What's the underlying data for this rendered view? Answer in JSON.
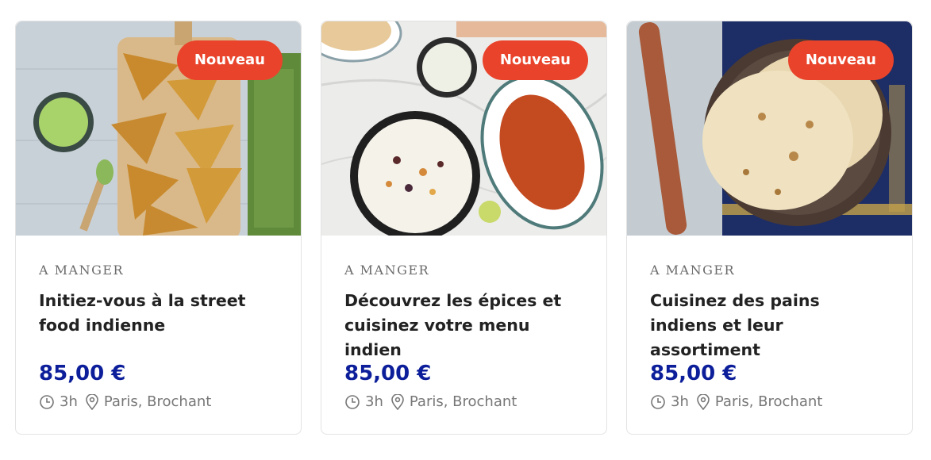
{
  "cards": [
    {
      "image": "samosas-with-green-chutney",
      "badge": "Nouveau",
      "category": "A MANGER",
      "title": "Initiez-vous à la street food indienne",
      "price": "85,00 €",
      "duration": "3h",
      "location": "Paris, Brochant"
    },
    {
      "image": "rice-curry-and-raita",
      "badge": "Nouveau",
      "category": "A MANGER",
      "title": "Découvrez les épices et cuisinez votre menu indien",
      "price": "85,00 €",
      "duration": "3h",
      "location": "Paris, Brochant"
    },
    {
      "image": "indian-flatbreads-naan",
      "badge": "Nouveau",
      "category": "A MANGER",
      "title": "Cuisinez des pains indiens et leur assortiment",
      "price": "85,00 €",
      "duration": "3h",
      "location": "Paris, Brochant"
    }
  ],
  "colors": {
    "badge_bg": "#e9442b",
    "price": "#0c1e9a",
    "category": "#6b6b6b",
    "meta": "#777777",
    "card_border": "#e3e3e3"
  }
}
